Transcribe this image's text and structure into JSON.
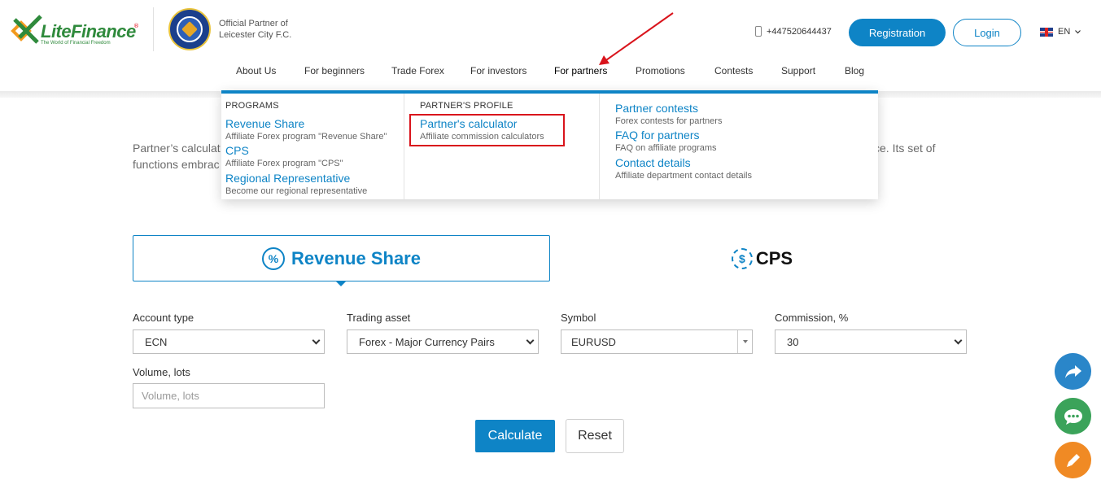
{
  "header": {
    "logo_text": "LiteFinance",
    "logo_tagline": "The World of Financial Freedom",
    "partner_line1": "Official Partner of",
    "partner_line2": "Leicester City F.C.",
    "phone": "+447520644437",
    "register_label": "Registration",
    "login_label": "Login",
    "language": "EN",
    "crest_icon": "leicester-city-crest"
  },
  "nav": {
    "items": [
      {
        "label": "About Us"
      },
      {
        "label": "For beginners"
      },
      {
        "label": "Trade Forex"
      },
      {
        "label": "For investors"
      },
      {
        "label": "For partners"
      },
      {
        "label": "Promotions"
      },
      {
        "label": "Contests"
      },
      {
        "label": "Support"
      },
      {
        "label": "Blog"
      }
    ],
    "active": "For partners"
  },
  "dropdown": {
    "programs": {
      "heading": "PROGRAMS",
      "links": [
        {
          "title": "Revenue Share",
          "desc": "Affiliate Forex program \"Revenue Share\""
        },
        {
          "title": "CPS",
          "desc": "Affiliate Forex program \"CPS\""
        },
        {
          "title": "Regional Representative",
          "desc": "Become our regional representative"
        }
      ]
    },
    "profile": {
      "heading": "PARTNER'S PROFILE",
      "links": [
        {
          "title": "Partner's calculator",
          "desc": "Affiliate commission calculators"
        }
      ]
    },
    "other": {
      "links": [
        {
          "title": "Partner contests",
          "desc": "Forex contests for partners"
        },
        {
          "title": "FAQ for partners",
          "desc": "FAQ on affiliate programs"
        },
        {
          "title": "Contact details",
          "desc": "Affiliate department contact details"
        }
      ]
    }
  },
  "intro": {
    "line1_left": "Partner’s calculat",
    "line1_right": "ce. Its set of",
    "line2_left": "functions embrac"
  },
  "tabs": {
    "revenue_share": {
      "label": "Revenue Share",
      "icon": "%"
    },
    "cps": {
      "label": "CPS",
      "icon": "$"
    }
  },
  "form": {
    "account_type": {
      "label": "Account type",
      "value": "ECN"
    },
    "trading_asset": {
      "label": "Trading asset",
      "value": "Forex - Major Currency Pairs"
    },
    "symbol": {
      "label": "Symbol",
      "value": "EURUSD"
    },
    "commission": {
      "label": "Commission, %",
      "value": "30"
    },
    "volume": {
      "label": "Volume, lots",
      "placeholder": "Volume, lots"
    },
    "calculate_label": "Calculate",
    "reset_label": "Reset"
  },
  "colors": {
    "brand_blue": "#0e84c6",
    "brand_green": "#2f8a3c",
    "annotation_red": "#d9141c"
  }
}
